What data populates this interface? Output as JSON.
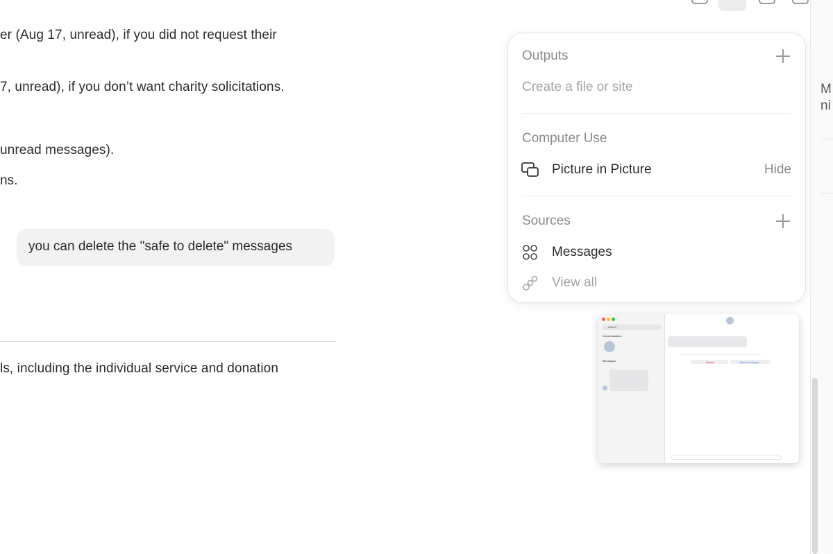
{
  "chat": {
    "line1": "er (Aug 17, unread), if you did not request their",
    "line2": "7, unread), if you don’t want charity solicitations.",
    "line3": "unread messages).",
    "line4": "ns.",
    "user_message": "you can delete the \"safe to delete\" messages",
    "line5": "ls, including the individual service and donation"
  },
  "toolbar": {
    "icons": [
      "window-icon",
      "layout-icon",
      "panel-icon",
      "square-icon"
    ]
  },
  "panel": {
    "outputs_title": "Outputs",
    "outputs_placeholder": "Create a file or site",
    "computer_use_title": "Computer Use",
    "pip_label": "Picture in Picture",
    "pip_action": "Hide",
    "sources_title": "Sources",
    "messages_label": "Messages",
    "view_all_label": "View all"
  },
  "right_edge": {
    "frag1": "M",
    "frag2": "ni"
  },
  "pip_window": {
    "search": "search",
    "conversations": "Conversations",
    "messages": "Messages",
    "delete": "Delete",
    "mark_safe": "Mark as Known"
  }
}
